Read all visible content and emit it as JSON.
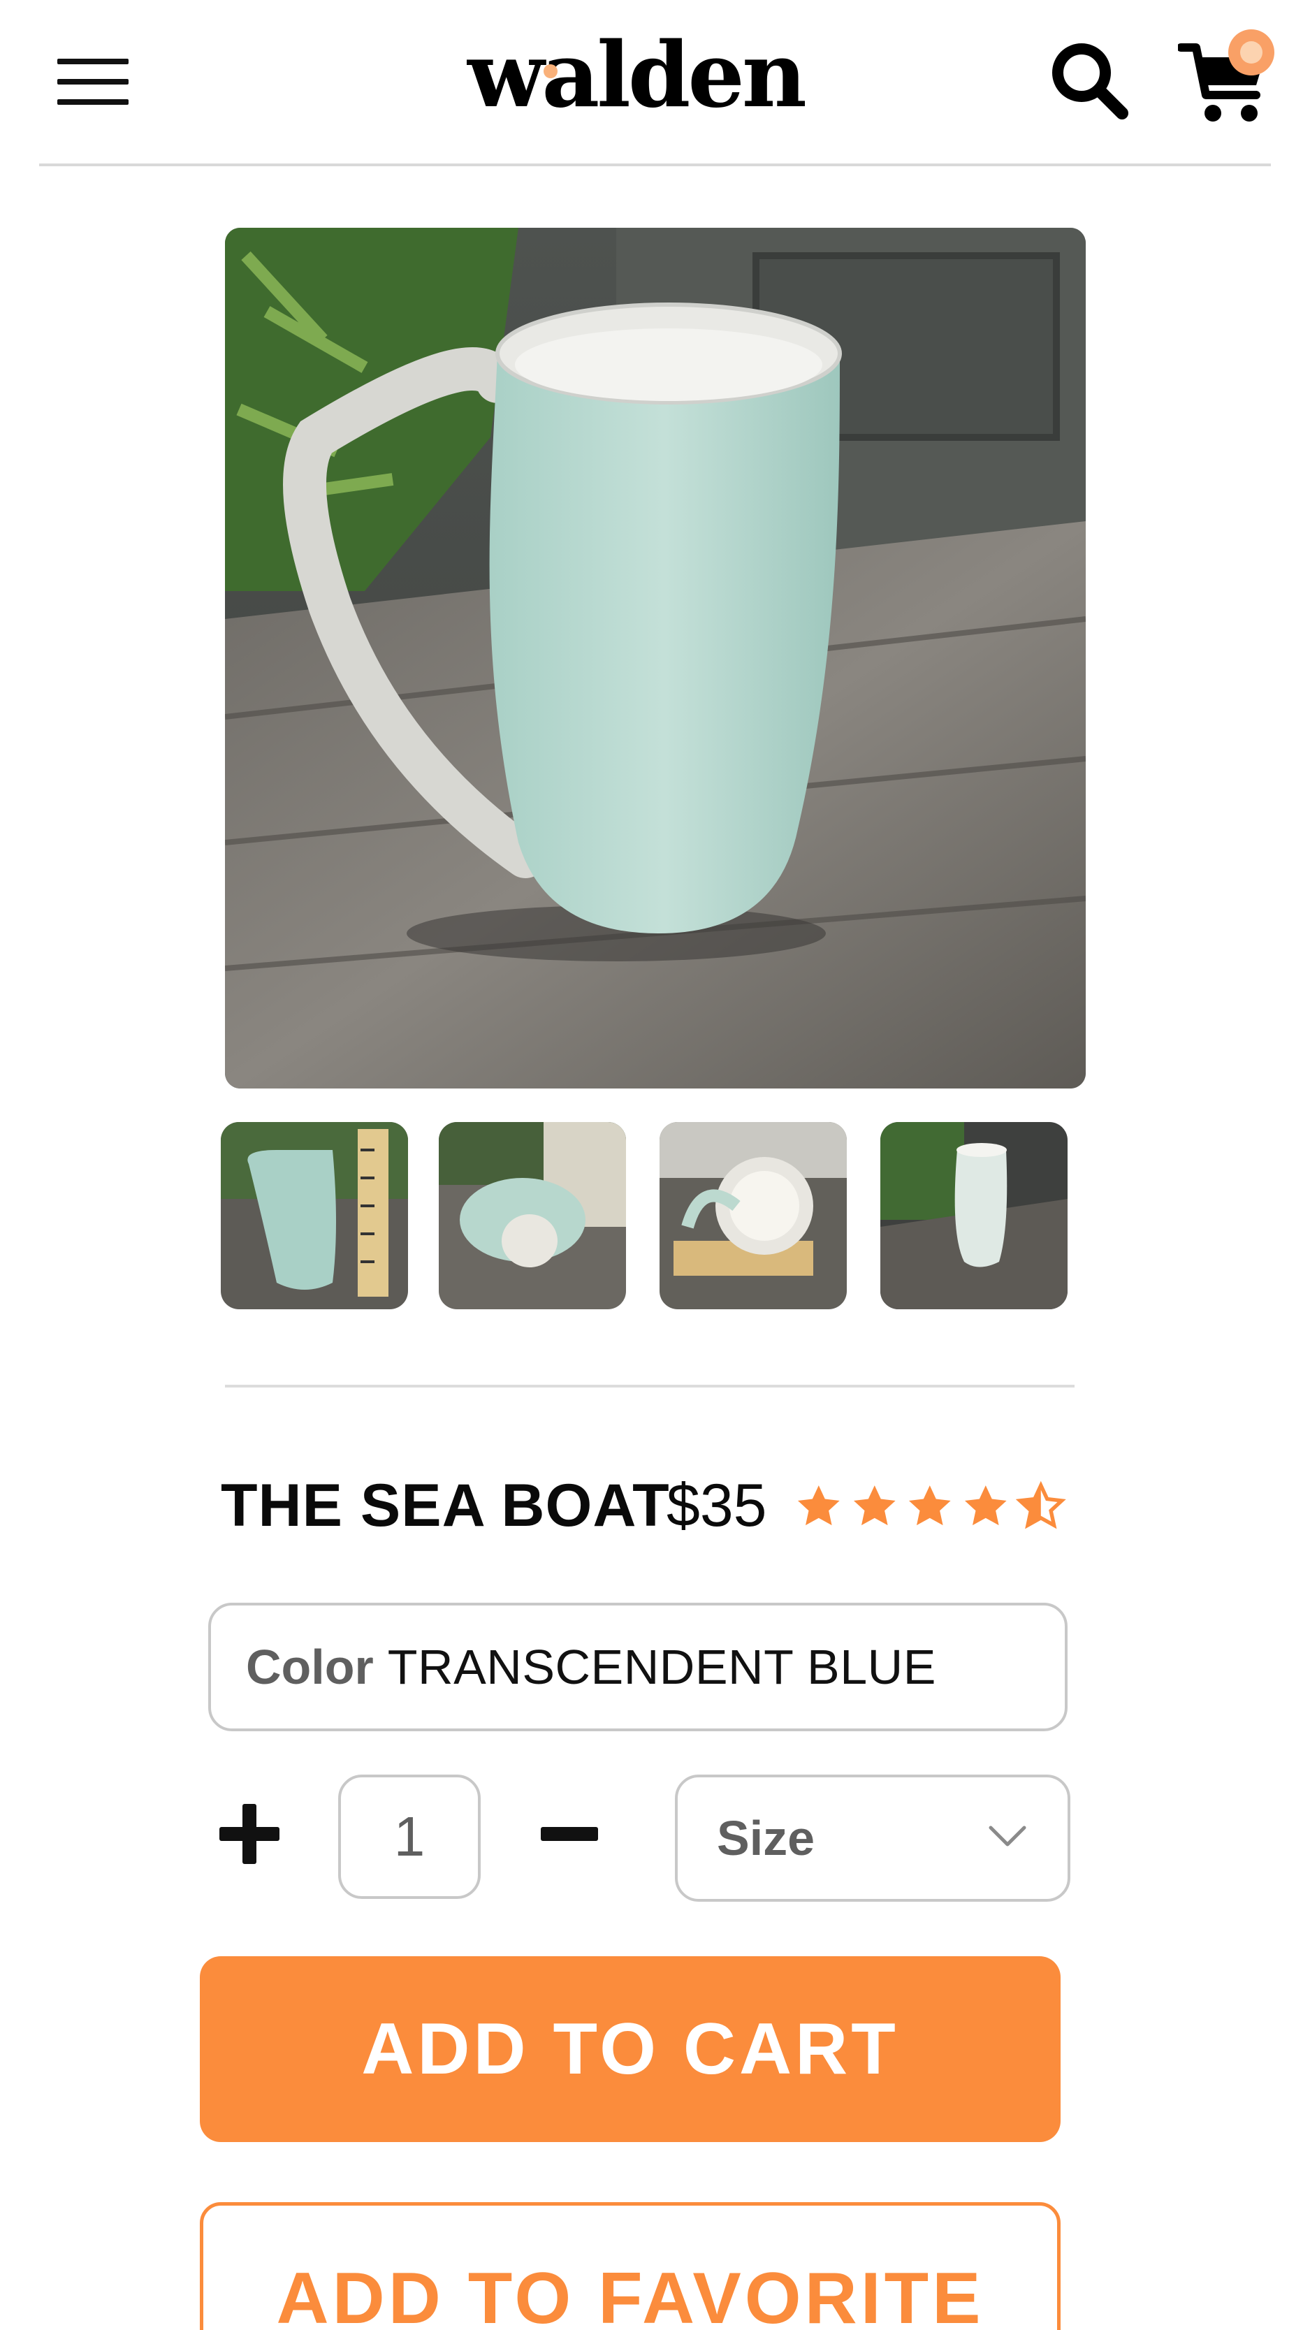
{
  "header": {
    "logo_text": "walden",
    "cart_badge_color": "#f9a066"
  },
  "product": {
    "title": "THE SEA BOAT",
    "price": "$35",
    "rating": 4.5,
    "rating_max": 5,
    "rating_color": "#fb8c3c",
    "color_label": "Color",
    "color_value": "TRANSCENDENT BLUE",
    "quantity": "1",
    "size_placeholder": "Size",
    "gallery_count": 4
  },
  "actions": {
    "add_to_cart": "ADD TO CART",
    "add_to_favorite": "ADD TO FAVORITE"
  },
  "icons": [
    "menu-icon",
    "search-icon",
    "cart-icon",
    "star-icon",
    "chevron-down-icon",
    "plus-icon",
    "minus-icon"
  ],
  "colors": {
    "accent": "#fb8c3c",
    "border": "#c8c8c8",
    "text": "#111111"
  }
}
